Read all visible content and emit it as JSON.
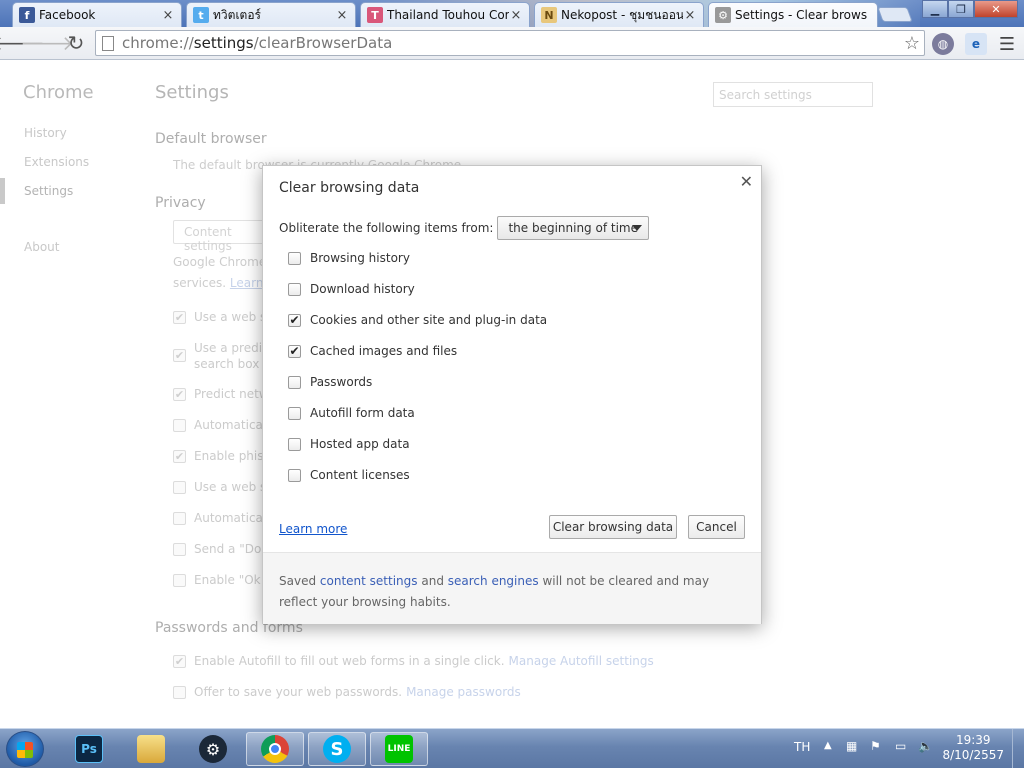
{
  "tabs": [
    {
      "title": "Facebook",
      "icon": "facebook-icon"
    },
    {
      "title": "ทวิตเตอร์",
      "icon": "twitter-icon"
    },
    {
      "title": "Thailand Touhou Com",
      "icon": "touhou-icon"
    },
    {
      "title": "Nekopost - ชุมชนออนไ",
      "icon": "nekopost-icon"
    },
    {
      "title": "Settings - Clear brows",
      "icon": "settings-icon"
    }
  ],
  "omnibox": {
    "scheme": "chrome://",
    "host": "settings",
    "path": "/clearBrowserData"
  },
  "settings_page": {
    "sidebar_title": "Chrome",
    "nav": [
      "History",
      "Extensions",
      "Settings",
      "About"
    ],
    "title": "Settings",
    "search_placeholder": "Search settings",
    "default_browser_heading": "Default browser",
    "default_browser_text": "The default browser is currently Google Chrome.",
    "privacy_heading": "Privacy",
    "content_settings_button": "Content settings",
    "privacy_text_1": "Google Chrome",
    "privacy_text_2": "services.",
    "learn_more": "Learn more",
    "privacy_options": [
      {
        "label": "Use a web se",
        "checked": true
      },
      {
        "label": "Use a predict",
        "label2": "search box",
        "checked": true
      },
      {
        "label": "Predict netw",
        "checked": true
      },
      {
        "label": "Automatically",
        "checked": false
      },
      {
        "label": "Enable phish",
        "checked": true
      },
      {
        "label": "Use a web se",
        "checked": false
      },
      {
        "label": "Automatically",
        "checked": false
      },
      {
        "label": "Send a \"Do N",
        "checked": false
      },
      {
        "label": "Enable \"Ok G",
        "checked": false
      }
    ],
    "passwords_heading": "Passwords and forms",
    "autofill_label": "Enable Autofill to fill out web forms in a single click.",
    "autofill_link": "Manage Autofill settings",
    "passwords_label": "Offer to save your web passwords.",
    "passwords_link": "Manage passwords"
  },
  "dialog": {
    "title": "Clear browsing data",
    "obliterate_label": "Obliterate the following items from:",
    "time_range": "the beginning of time",
    "items": [
      {
        "label": "Browsing history",
        "checked": false
      },
      {
        "label": "Download history",
        "checked": false
      },
      {
        "label": "Cookies and other site and plug-in data",
        "checked": true
      },
      {
        "label": "Cached images and files",
        "checked": true
      },
      {
        "label": "Passwords",
        "checked": false
      },
      {
        "label": "Autofill form data",
        "checked": false
      },
      {
        "label": "Hosted app data",
        "checked": false
      },
      {
        "label": "Content licenses",
        "checked": false
      }
    ],
    "learn_more": "Learn more",
    "clear_button": "Clear browsing data",
    "cancel_button": "Cancel",
    "footer_1": "Saved",
    "footer_link_1": "content settings",
    "footer_2": "and",
    "footer_link_2": "search engines",
    "footer_3": "will not be cleared and may reflect your browsing habits."
  },
  "taskbar": {
    "apps": [
      {
        "name": "photoshop",
        "label": "Ps"
      },
      {
        "name": "explorer",
        "label": ""
      },
      {
        "name": "steam",
        "label": ""
      },
      {
        "name": "chrome",
        "label": ""
      },
      {
        "name": "skype",
        "label": "S"
      },
      {
        "name": "line",
        "label": "LINE"
      }
    ],
    "language": "TH",
    "time": "19:39",
    "date": "8/10/2557"
  },
  "colors": {
    "link": "#1155cc",
    "taskbar": "#6884b0",
    "tabstrip": "#4d74b8"
  }
}
